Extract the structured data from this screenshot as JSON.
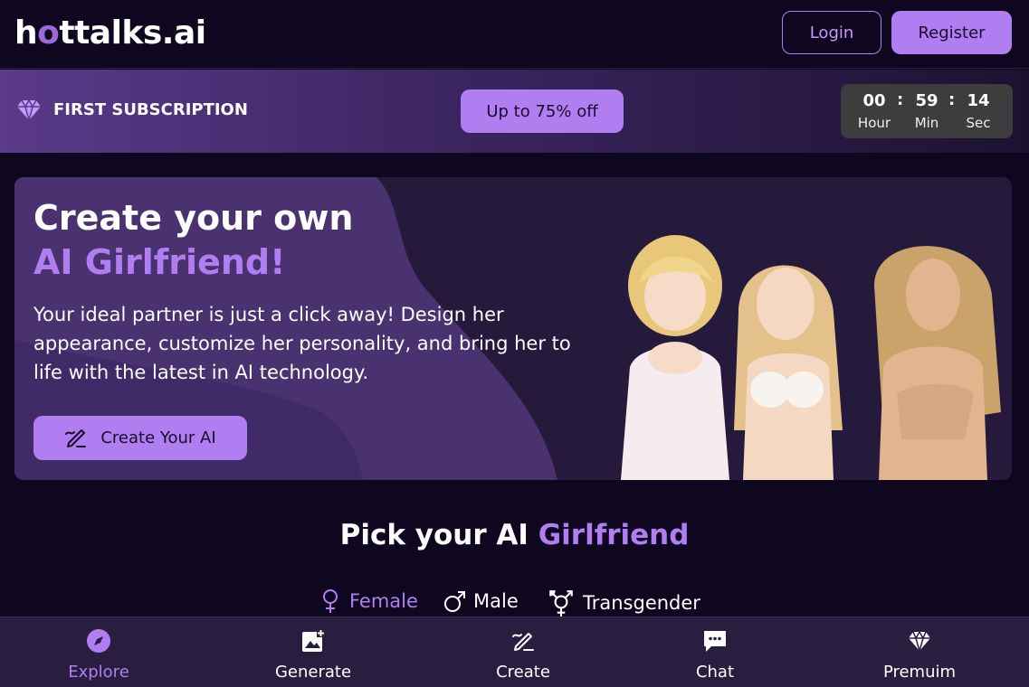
{
  "header": {
    "logo_prefix": "h",
    "logo_accent": "o",
    "logo_suffix": "ttalks.ai",
    "login_label": "Login",
    "register_label": "Register"
  },
  "promo": {
    "title": "FIRST SUBSCRIPTION",
    "button_label": "Up to 75% off",
    "timer": {
      "hours": "00",
      "minutes": "59",
      "seconds": "14",
      "hours_label": "Hour",
      "minutes_label": "Min",
      "seconds_label": "Sec",
      "separator": ":"
    }
  },
  "hero": {
    "title_line1": "Create your own",
    "title_line2": "AI Girlfriend!",
    "description": "Your ideal partner is just a click away! Design her appearance, customize her personality, and bring her to life with the latest in AI technology.",
    "button_label": "Create Your AI"
  },
  "pick": {
    "title_prefix": "Pick your AI ",
    "title_accent": "Girlfriend",
    "genders": [
      {
        "label": "Female",
        "icon": "female-icon",
        "active": true
      },
      {
        "label": "Male",
        "icon": "male-icon",
        "active": false
      },
      {
        "label": "Transgender",
        "icon": "transgender-icon",
        "active": false
      }
    ]
  },
  "bottom_nav": {
    "items": [
      {
        "label": "Explore",
        "icon": "compass-icon",
        "active": true
      },
      {
        "label": "Generate",
        "icon": "image-add-icon",
        "active": false
      },
      {
        "label": "Create",
        "icon": "pen-edit-icon",
        "active": false
      },
      {
        "label": "Chat",
        "icon": "chat-bubble-icon",
        "active": false
      },
      {
        "label": "Premuim",
        "icon": "diamond-icon",
        "active": false
      }
    ]
  },
  "colors": {
    "accent": "#b07ef0",
    "background": "#0f0620",
    "nav_background": "#2a1e40",
    "timer_background": "#3d3d3d"
  }
}
